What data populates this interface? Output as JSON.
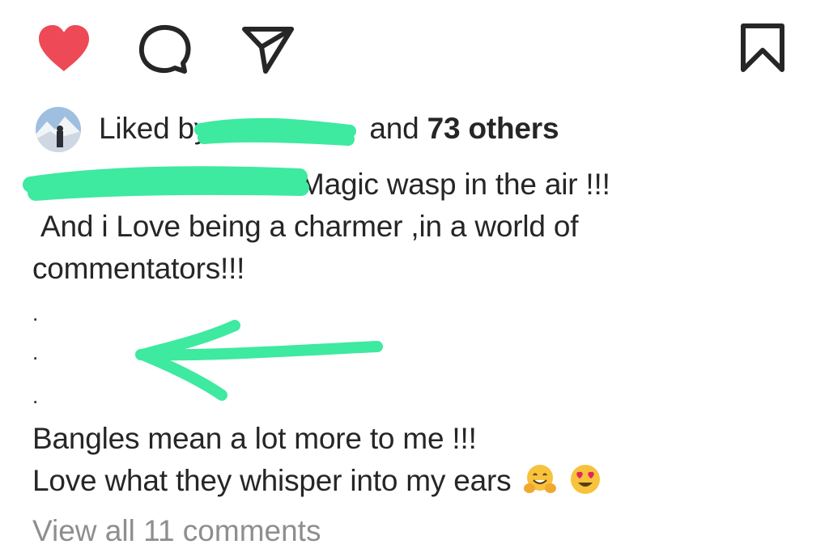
{
  "actions": {
    "like_icon": "heart-filled-icon",
    "comment_icon": "speech-bubble-icon",
    "share_icon": "paper-plane-icon",
    "save_icon": "bookmark-icon",
    "like_color": "#ed4956"
  },
  "likes": {
    "prefix": "Liked by",
    "suffix": "and",
    "others": "73 others"
  },
  "caption": {
    "line1": "Magic wasp in the air !!!",
    "line2": "And i Love being a charmer ,in a world of",
    "line3": "commentators!!!",
    "dot1": ".",
    "dot2": ".",
    "dot3": ".",
    "line4": "Bangles mean a lot more to me !!!",
    "line5": "Love what they whisper into my ears"
  },
  "view_comments": "View all 11 comments",
  "colors": {
    "text": "#262626",
    "secondary": "#8e8e8e",
    "highlighter": "#3ee9a0"
  }
}
